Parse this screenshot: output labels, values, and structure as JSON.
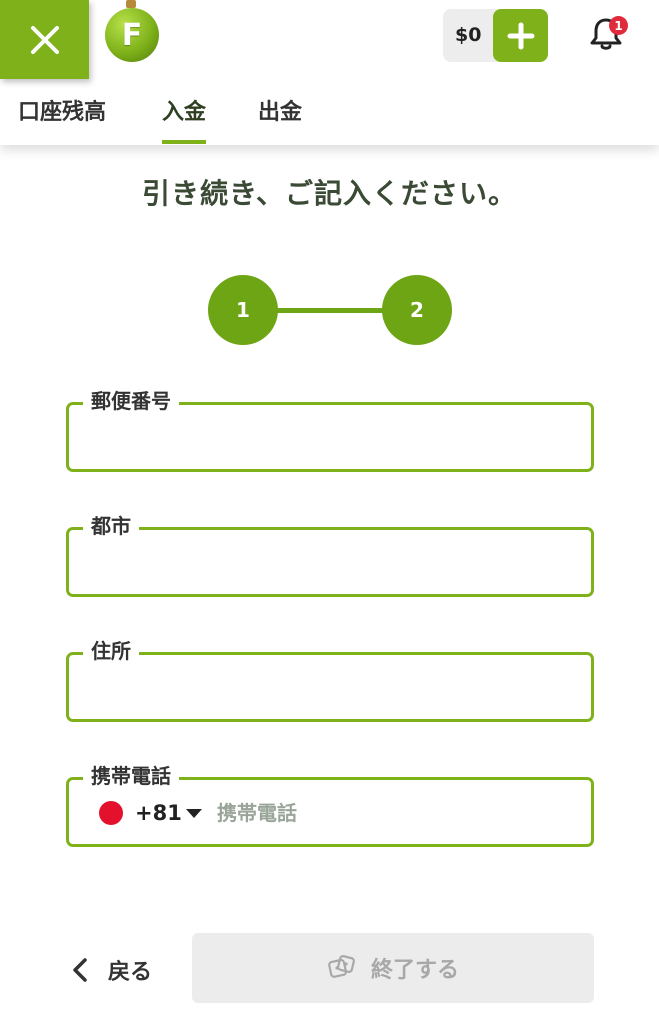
{
  "header": {
    "logo_letter": "F",
    "balance": "$0",
    "notification_count": "1"
  },
  "tabs": [
    {
      "label": "口座残高",
      "active": false
    },
    {
      "label": "入金",
      "active": true
    },
    {
      "label": "出金",
      "active": false
    }
  ],
  "heading": "引き続き、ご記入ください。",
  "stepper": {
    "steps": [
      "1",
      "2"
    ]
  },
  "form": {
    "postal_code": {
      "label": "郵便番号",
      "value": ""
    },
    "city": {
      "label": "都市",
      "value": ""
    },
    "address": {
      "label": "住所",
      "value": ""
    },
    "mobile": {
      "label": "携帯電話",
      "country_code": "+81",
      "placeholder": "携帯電話",
      "value": ""
    }
  },
  "footer": {
    "back_label": "戻る",
    "finish_label": "終了する"
  },
  "colors": {
    "accent": "#7fb21a",
    "badge": "#e02b3d",
    "flag": "#e3112b",
    "disabled_bg": "#ececec"
  }
}
